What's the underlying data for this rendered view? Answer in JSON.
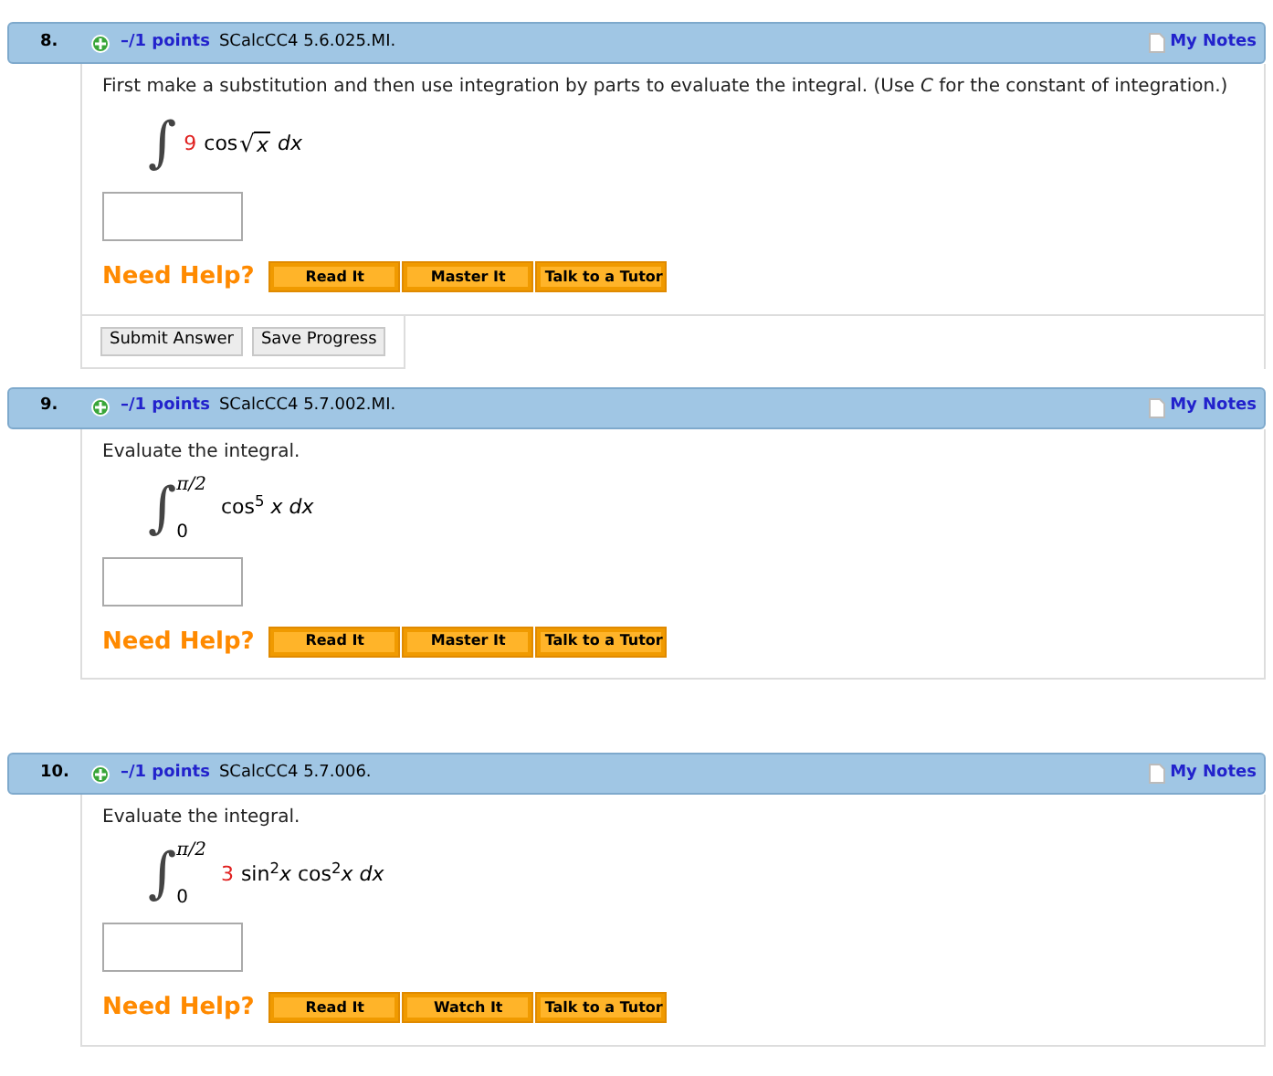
{
  "questions": [
    {
      "number": "8.",
      "points": "–/1 points",
      "code": "SCalcCC4 5.6.025.MI.",
      "notes": "My Notes",
      "prompt": "First make a substitution and then use integration by parts to evaluate the integral. (Use *C* for the constant of integration.)",
      "integral": {
        "sign": "∫",
        "radical": "√",
        "coefficient": "9",
        "before": "cos",
        "radicand": "x",
        "after": "*dx*"
      },
      "help_label": "Need Help?",
      "help_buttons": [
        "Read It",
        "Master It",
        "Talk to a Tutor"
      ],
      "actions": [
        "Submit Answer",
        "Save Progress"
      ]
    },
    {
      "number": "9.",
      "points": "–/1 points",
      "code": "SCalcCC4 5.7.002.MI.",
      "notes": "My Notes",
      "prompt": "Evaluate the integral.",
      "integral": {
        "sign": "∫",
        "upper": "π/2",
        "lower": "0",
        "before": "cos$^{5}$ *x dx*"
      },
      "help_label": "Need Help?",
      "help_buttons": [
        "Read It",
        "Master It",
        "Talk to a Tutor"
      ]
    },
    {
      "number": "10.",
      "points": "–/1 points",
      "code": "SCalcCC4 5.7.006.",
      "notes": "My Notes",
      "prompt": "Evaluate the integral.",
      "integral": {
        "sign": "∫",
        "upper": "π/2",
        "lower": "0",
        "coefficient": "3",
        "before": "sin$^{2}$*x* cos$^{2}$*x dx*"
      },
      "help_label": "Need Help?",
      "help_buttons": [
        "Read It",
        "Watch It",
        "Talk to a Tutor"
      ]
    }
  ]
}
